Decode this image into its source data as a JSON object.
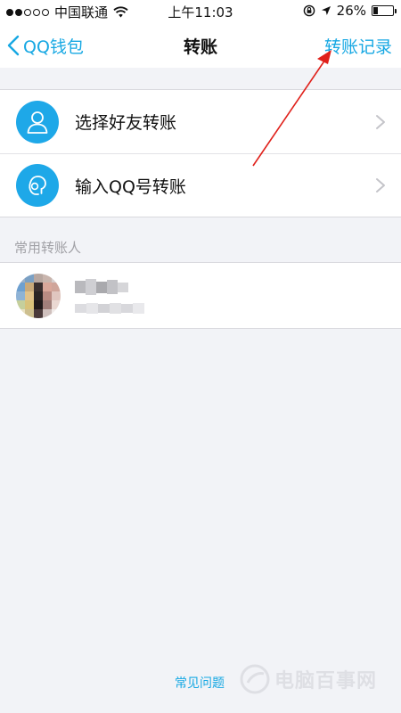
{
  "status_bar": {
    "carrier": "中国联通",
    "time": "上午11:03",
    "battery": "26%",
    "battery_level": 0.26
  },
  "nav": {
    "back_label": "QQ钱包",
    "title": "转账",
    "right_label": "转账记录"
  },
  "transfer_options": [
    {
      "label": "选择好友转账",
      "icon": "person-icon"
    },
    {
      "label": "输入QQ号转账",
      "icon": "person-badge-icon"
    }
  ],
  "frequent": {
    "header": "常用转账人"
  },
  "footer": {
    "faq_label": "常见问题",
    "watermark": "电脑百事网"
  },
  "colors": {
    "accent": "#17a8e3",
    "icon_bg": "#1ea8e8",
    "annotation_arrow": "#e0211b"
  }
}
